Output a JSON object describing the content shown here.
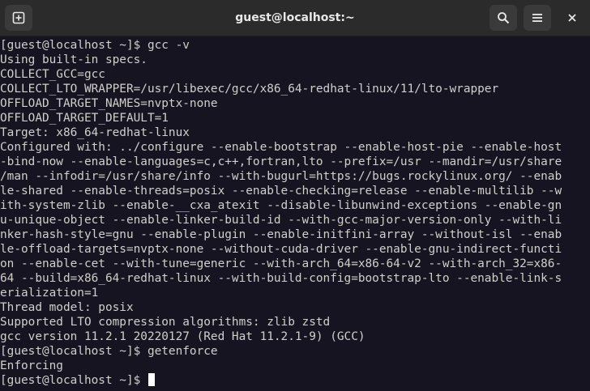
{
  "window": {
    "title": "guest@localhost:~"
  },
  "icons": {
    "new_tab": "new-tab-icon",
    "search": "search-icon",
    "menu": "hamburger-menu-icon",
    "close": "close-icon"
  },
  "terminal": {
    "lines": [
      "[guest@localhost ~]$ gcc -v",
      "Using built-in specs.",
      "COLLECT_GCC=gcc",
      "COLLECT_LTO_WRAPPER=/usr/libexec/gcc/x86_64-redhat-linux/11/lto-wrapper",
      "OFFLOAD_TARGET_NAMES=nvptx-none",
      "OFFLOAD_TARGET_DEFAULT=1",
      "Target: x86_64-redhat-linux",
      "Configured with: ../configure --enable-bootstrap --enable-host-pie --enable-host",
      "-bind-now --enable-languages=c,c++,fortran,lto --prefix=/usr --mandir=/usr/share",
      "/man --infodir=/usr/share/info --with-bugurl=https://bugs.rockylinux.org/ --enab",
      "le-shared --enable-threads=posix --enable-checking=release --enable-multilib --w",
      "ith-system-zlib --enable-__cxa_atexit --disable-libunwind-exceptions --enable-gn",
      "u-unique-object --enable-linker-build-id --with-gcc-major-version-only --with-li",
      "nker-hash-style=gnu --enable-plugin --enable-initfini-array --without-isl --enab",
      "le-offload-targets=nvptx-none --without-cuda-driver --enable-gnu-indirect-functi",
      "on --enable-cet --with-tune=generic --with-arch_64=x86-64-v2 --with-arch_32=x86-",
      "64 --build=x86_64-redhat-linux --with-build-config=bootstrap-lto --enable-link-s",
      "erialization=1",
      "Thread model: posix",
      "Supported LTO compression algorithms: zlib zstd",
      "gcc version 11.2.1 20220127 (Red Hat 11.2.1-9) (GCC)",
      "[guest@localhost ~]$ getenforce",
      "Enforcing"
    ],
    "prompt": "[guest@localhost ~]$ "
  },
  "colors": {
    "terminal_bg": "#171421",
    "terminal_fg": "#d0cfcc",
    "titlebar_bg": "#2b2b2b"
  }
}
